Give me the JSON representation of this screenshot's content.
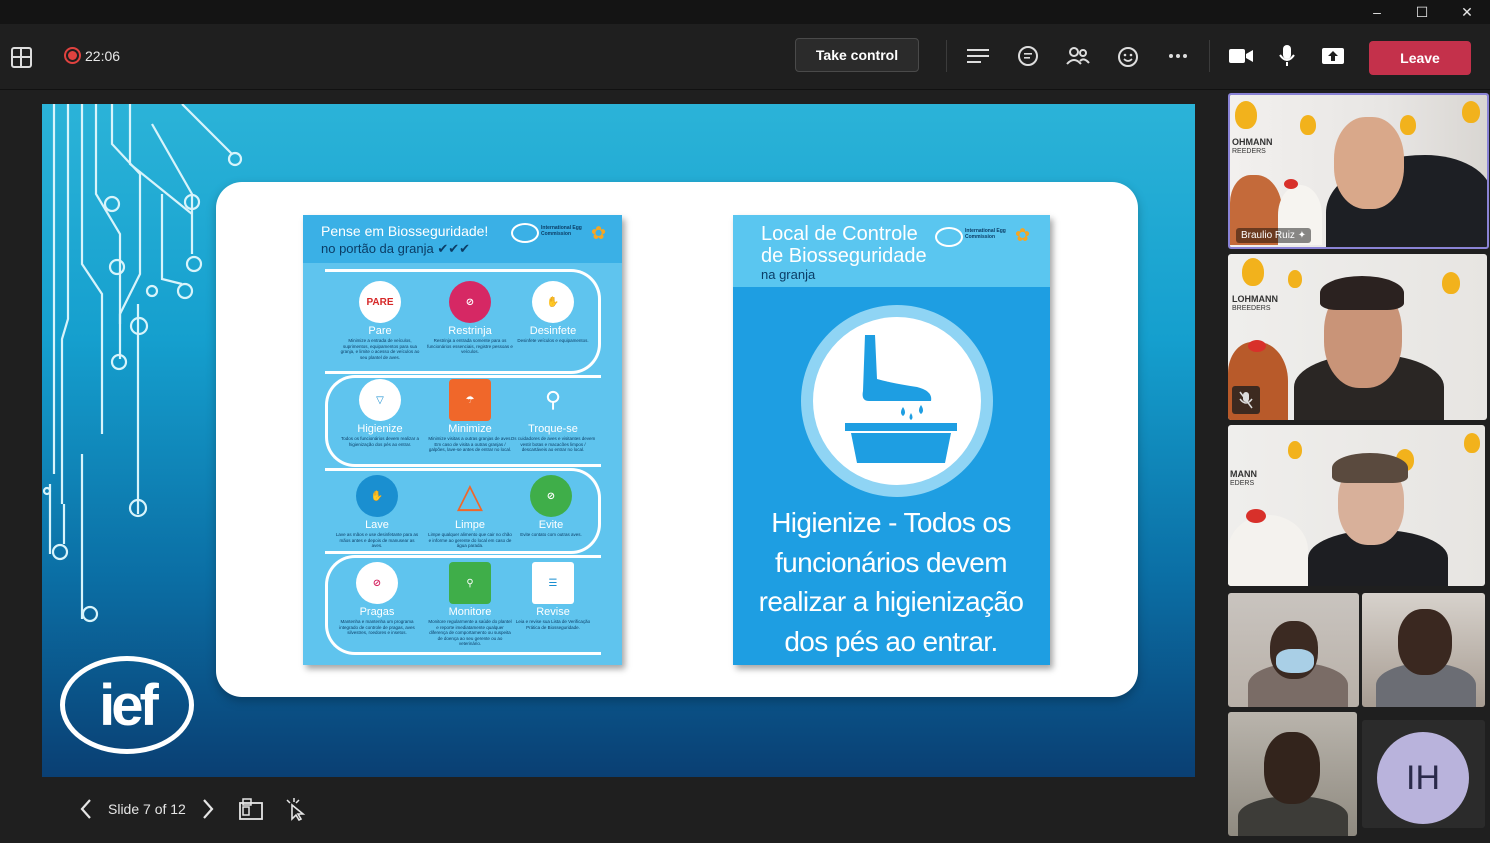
{
  "window": {
    "minimize": "–",
    "maximize": "☐",
    "close": "✕"
  },
  "toolbar": {
    "recording_time": "22:06",
    "take_control_label": "Take control",
    "leave_label": "Leave",
    "icons": [
      "grid-icon",
      "chat-list-icon",
      "chat-icon",
      "people-icon",
      "reactions-icon",
      "more-icon",
      "camera-icon",
      "mic-icon",
      "share-icon"
    ]
  },
  "slide": {
    "poster1": {
      "title": "Pense em Biosseguridade!",
      "subtitle": "no portão da granja ✔✔✔",
      "logo_text": "International Egg Commission",
      "items": [
        {
          "label": "Pare",
          "icon_text": "PARE",
          "desc": "Minimize a entrada de veículos, suprimentos, equipamentos para sua granja, e limite o acesso de veículos ao seu plantel de aves."
        },
        {
          "label": "Restrinja",
          "icon_text": "",
          "desc": "Restrinja a entrada somente para os funcionários essenciais, registre pessoas e veículos."
        },
        {
          "label": "Desinfete",
          "icon_text": "",
          "desc": "Desinfete veículos e equipamentos."
        },
        {
          "label": "Higienize",
          "icon_text": "",
          "desc": "Todos os funcionários devem realizar a higienização dos pés ao entrar."
        },
        {
          "label": "Minimize",
          "icon_text": "",
          "desc": "Minimize visitas a outras granjas de aves. Em caso de visita a outras granjas / galpões, lave-se antes de entrar no local."
        },
        {
          "label": "Troque-se",
          "icon_text": "",
          "desc": "Os cuidadores de aves e visitantes devem vestir botas e macacões limpos / descartáveis ao entrar no local."
        },
        {
          "label": "Lave",
          "icon_text": "",
          "desc": "Lave as mãos e use desinfetante para as mãos antes e depois de manusear as aves."
        },
        {
          "label": "Limpe",
          "icon_text": "",
          "desc": "Limpe qualquer alimento que cair no chão e informe ao gerente do local em caso de água parada."
        },
        {
          "label": "Evite",
          "icon_text": "",
          "desc": "Evite contato com outras aves."
        },
        {
          "label": "Pragas",
          "icon_text": "",
          "desc": "Mantenha e mantenha um programa integrado de controle de pragas, aves silvestres, roedores e insetos."
        },
        {
          "label": "Monitore",
          "icon_text": "",
          "desc": "Monitore regularmente a saúde do plantel e reporte imediatamente qualquer diferença de comportamento ou suspeita de doença ao seu gerente ou ao veterinário."
        },
        {
          "label": "Revise",
          "icon_text": "",
          "desc": "Leia e revise sua Lista de Verificação Prática de Biosseguridade."
        }
      ]
    },
    "poster2": {
      "title_line1": "Local de Controle",
      "title_line2": "de Biosseguridade",
      "title_line3": "na granja",
      "logo_text": "International Egg Commission",
      "main_text": "Higienize - Todos os funcionários devem realizar a higienização dos pés ao entrar."
    },
    "logo": "ief"
  },
  "slide_controls": {
    "counter": "Slide 7 of 12"
  },
  "participants": [
    {
      "name": "Braulio Ruiz",
      "pinned": true,
      "muted": false
    },
    {
      "name": "",
      "pinned": false,
      "muted": true
    },
    {
      "name": "",
      "pinned": false,
      "muted": false
    },
    {
      "name": "",
      "pinned": false,
      "muted": false
    },
    {
      "name": "",
      "pinned": false,
      "muted": false
    },
    {
      "name": "",
      "pinned": false,
      "muted": false
    },
    {
      "name": "",
      "pinned": false,
      "muted": false,
      "initials": "IH"
    }
  ],
  "brand": {
    "tile_logo_line1": "OHMANN",
    "tile_logo_line2": "REEDERS",
    "tile2_logo_line1": "LOHMANN",
    "tile2_logo_line2": "BREEDERS",
    "tile3_logo_line1": "MANN",
    "tile3_logo_line2": "EDERS"
  },
  "colors": {
    "leave": "#c4314b",
    "recording": "#e0423f",
    "slide_blue": "#2bb3d8"
  }
}
